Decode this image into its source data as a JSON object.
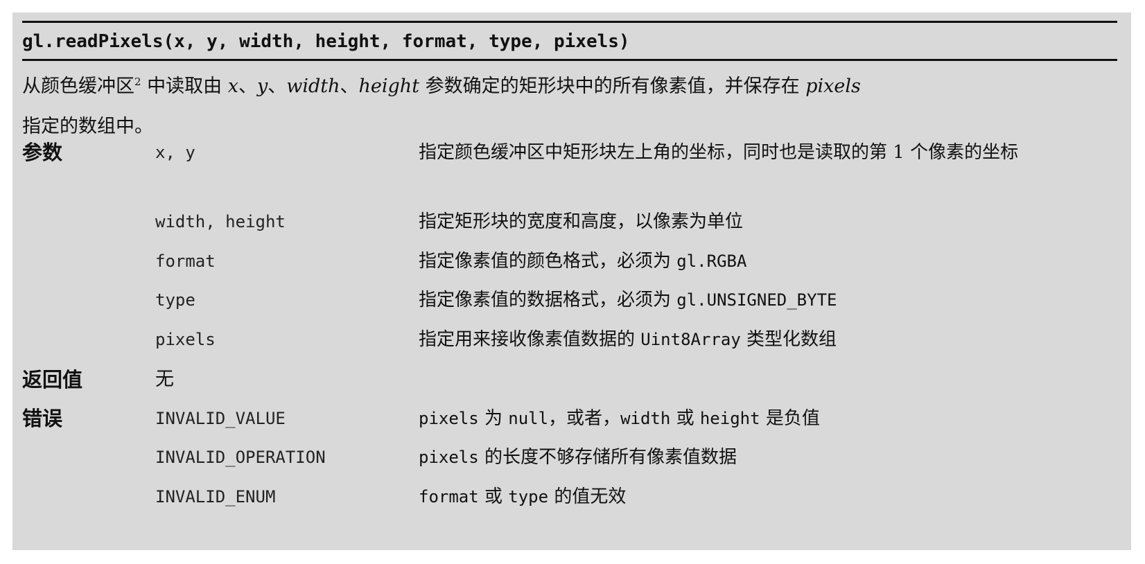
{
  "signature": "gl.readPixels(x, y, width, height, format, type, pixels)",
  "description": {
    "text1": "从颜色缓冲区",
    "sup": "2",
    "text2": "中读取由",
    "x": "x",
    "sep1": "、",
    "y": "y",
    "sep2": "、",
    "width": "width",
    "sep3": "、",
    "height": "height",
    "text3": "参数确定的矩形块中的所有像素值，并保存在",
    "pixels": "pixels",
    "text4": "指定的数组中。"
  },
  "sections": {
    "params_label": "参数",
    "return_label": "返回值",
    "errors_label": "错误"
  },
  "params": [
    {
      "name": "x, y",
      "desc": "指定颜色缓冲区中矩形块左上角的坐标，同时也是读取的第 1 个像素的坐标"
    },
    {
      "name": "width, height",
      "desc": "指定矩形块的宽度和高度，以像素为单位"
    },
    {
      "name": "format",
      "desc_pre": "指定像素值的颜色格式，必须为",
      "desc_code": "gl.RGBA"
    },
    {
      "name": "type",
      "desc_pre": "指定像素值的数据格式，必须为",
      "desc_code": "gl.UNSIGNED_BYTE"
    },
    {
      "name": "pixels",
      "desc_pre": "指定用来接收像素值数据的",
      "desc_code": "Uint8Array",
      "desc_post": "类型化数组"
    }
  ],
  "return_value": "无",
  "errors": [
    {
      "name": "INVALID_VALUE",
      "c1": "pixels",
      "t1": "为",
      "c2": "null",
      "t2": "，或者，",
      "c3": "width",
      "t3": "或",
      "c4": "height",
      "t4": "是负值"
    },
    {
      "name": "INVALID_OPERATION",
      "c1": "pixels",
      "t1": "的长度不够存储所有像素值数据"
    },
    {
      "name": "INVALID_ENUM",
      "c1": "format",
      "t1": "或",
      "c2": "type",
      "t2": "的值无效"
    }
  ]
}
